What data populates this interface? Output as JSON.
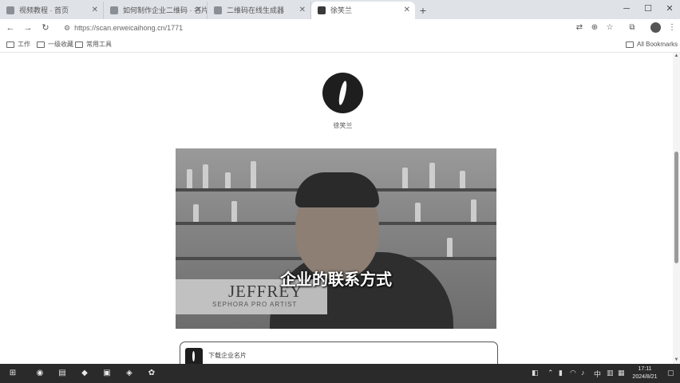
{
  "browser": {
    "tabs": [
      {
        "title": "视频教程 · 首页"
      },
      {
        "title": "如何制作企业二维码 · 名片"
      },
      {
        "title": "二维码在线生成器"
      },
      {
        "title": "徐笑兰"
      }
    ],
    "active_tab_index": 3,
    "address_bar": {
      "url": "https://scan.erweicaihong.cn/1771"
    },
    "bookmarks": [
      {
        "label": "工作"
      },
      {
        "label": "一级收藏"
      },
      {
        "label": "常用工具"
      }
    ],
    "all_bookmarks_label": "All Bookmarks"
  },
  "page": {
    "profile_name": "徐笑兰",
    "video": {
      "subtitle": "企业的联系方式",
      "lower_third_name": "JEFFREY",
      "lower_third_role": "SEPHORA PRO ARTIST"
    },
    "card": {
      "text": "下载企业名片"
    }
  },
  "taskbar": {
    "time": "17:11",
    "date": "2024/8/21"
  },
  "colors": {
    "avatar_bg": "#1e1e1e",
    "taskbar_bg": "#2a2a2a",
    "tabstrip_bg": "#dfe3e8"
  }
}
